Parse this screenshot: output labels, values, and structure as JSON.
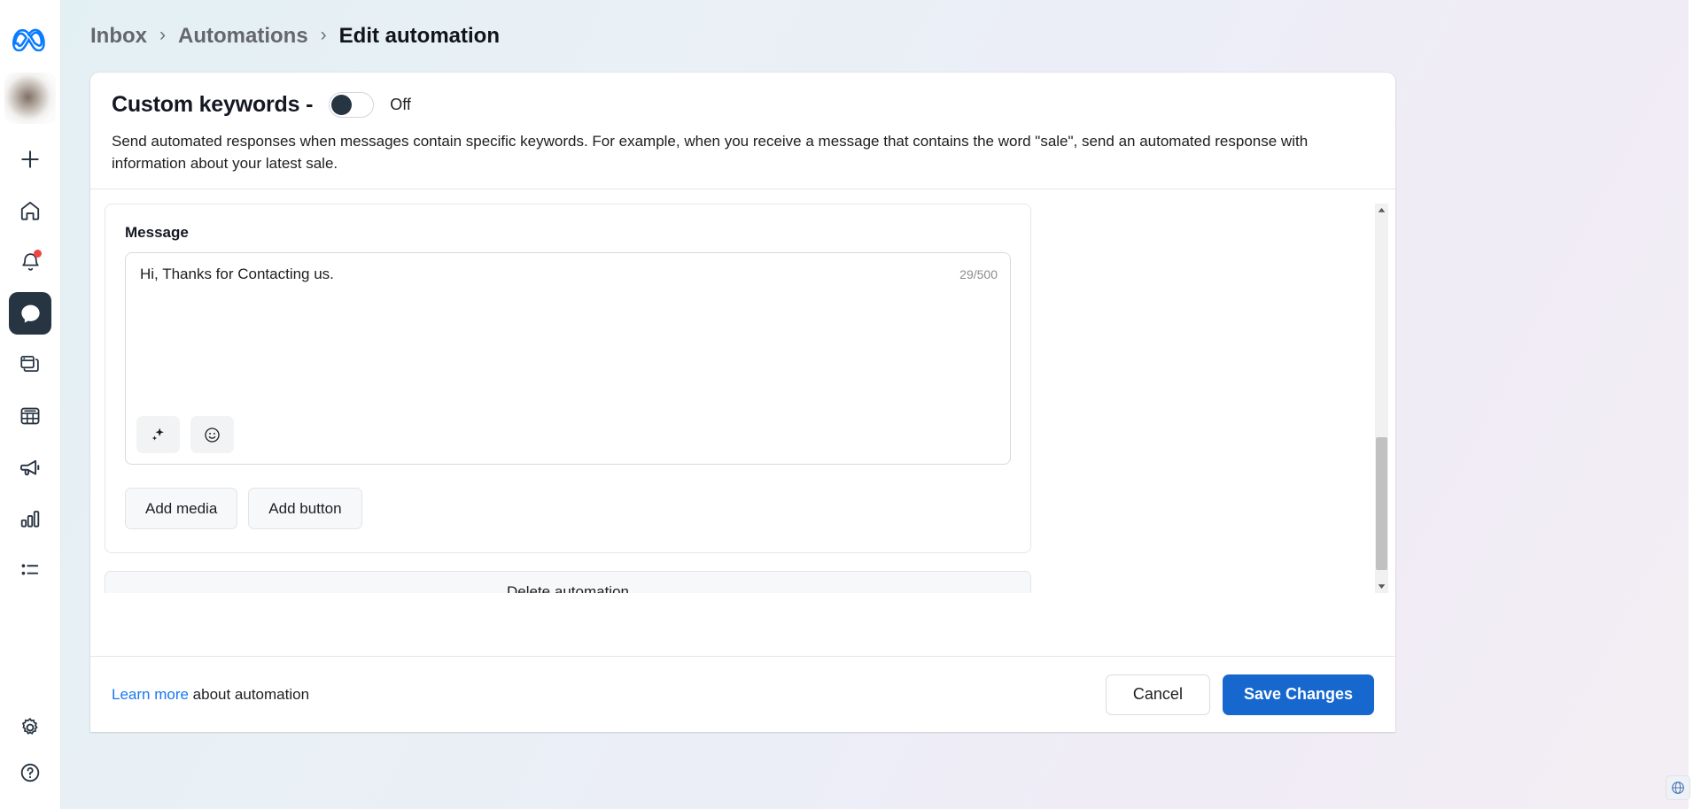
{
  "rail": {
    "logo": "meta-logo",
    "avatar": "user-avatar",
    "items": [
      {
        "icon": "plus-icon",
        "name": "create"
      },
      {
        "icon": "home-icon",
        "name": "home"
      },
      {
        "icon": "bell-icon",
        "name": "notifications",
        "badge": true
      },
      {
        "icon": "chat-bubble-icon",
        "name": "inbox",
        "active": true
      },
      {
        "icon": "posts-icon",
        "name": "posts"
      },
      {
        "icon": "grid-icon",
        "name": "planner"
      },
      {
        "icon": "megaphone-icon",
        "name": "ads"
      },
      {
        "icon": "bar-chart-icon",
        "name": "insights"
      },
      {
        "icon": "list-icon",
        "name": "all-tools"
      }
    ],
    "bottom": [
      {
        "icon": "gear-icon",
        "name": "settings"
      },
      {
        "icon": "help-icon",
        "name": "help"
      }
    ]
  },
  "breadcrumb": {
    "inbox": "Inbox",
    "automations": "Automations",
    "current": "Edit automation",
    "separator": "›"
  },
  "keywords": {
    "title": "Custom keywords -",
    "toggle_state": "Off",
    "description": "Send automated responses when messages contain specific keywords. For example, when you receive a message that contains the word \"sale\", send an automated response with information about your latest sale."
  },
  "message": {
    "label": "Message",
    "value": "Hi, Thanks for Contacting us.",
    "counter": "29/500",
    "ai_icon": "sparkle-icon",
    "emoji_icon": "emoji-icon",
    "add_media": "Add media",
    "add_button": "Add button"
  },
  "delete": {
    "label": "Delete automation"
  },
  "footer": {
    "learn_more": "Learn more",
    "learn_suffix": " about automation",
    "cancel": "Cancel",
    "save": "Save Changes"
  },
  "colors": {
    "accent": "#1668cf",
    "link": "#1877f2",
    "dark": "#273442",
    "badge": "#ef4444"
  }
}
